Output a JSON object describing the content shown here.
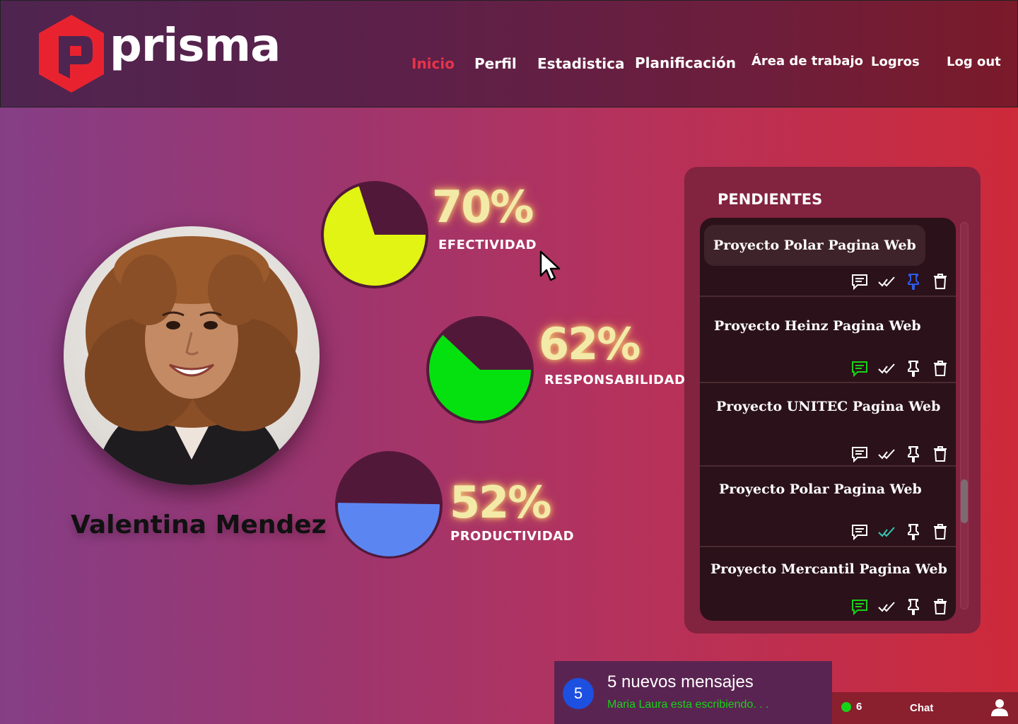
{
  "header": {
    "brand": "prisma",
    "nav": [
      {
        "label": "Inicio",
        "active": true
      },
      {
        "label": "Perfil"
      },
      {
        "label": "Estadistica"
      },
      {
        "label": "Planificación"
      },
      {
        "label": "Área de trabajo"
      },
      {
        "label": "Logros"
      },
      {
        "label": "Log out"
      }
    ]
  },
  "profile": {
    "name": "Valentina Mendez"
  },
  "metrics": [
    {
      "value": "70%",
      "label": "EFECTIVIDAD",
      "fraction": 0.7,
      "color": "#e1f413"
    },
    {
      "value": "62%",
      "label": "RESPONSABILIDAD",
      "fraction": 0.62,
      "color": "#05e10f"
    },
    {
      "value": "52%",
      "label": "PRODUCTIVIDAD",
      "fraction": 0.52,
      "color": "#5b86f2"
    }
  ],
  "pending": {
    "title": "PENDIENTES",
    "items": [
      {
        "title": "Proyecto Polar Pagina Web",
        "selected": true,
        "comment_active": false,
        "check_active": false,
        "pin_active": true
      },
      {
        "title": "Proyecto Heinz Pagina Web",
        "selected": false,
        "comment_active": true,
        "check_active": false,
        "pin_active": false
      },
      {
        "title": "Proyecto UNITEC Pagina Web",
        "selected": false,
        "comment_active": false,
        "check_active": false,
        "pin_active": false
      },
      {
        "title": "Proyecto Polar Pagina Web",
        "selected": false,
        "comment_active": false,
        "check_active": true,
        "pin_active": false
      },
      {
        "title": "Proyecto Mercantil Pagina Web",
        "selected": false,
        "comment_active": true,
        "check_active": false,
        "pin_active": false
      }
    ],
    "icons": [
      "comment-icon",
      "check-icon",
      "pin-icon",
      "trash-icon"
    ]
  },
  "messages": {
    "count": "5",
    "title": "5 nuevos mensajes",
    "typing": "Maria Laura esta escribiendo. . ."
  },
  "chat": {
    "online_count": "6",
    "label": "Chat"
  },
  "colors": {
    "accent": "#e8334a",
    "active_green": "#17d317",
    "pin_blue": "#2f5be6",
    "check_teal": "#32c7b5",
    "pie_remainder": "#52183a"
  }
}
